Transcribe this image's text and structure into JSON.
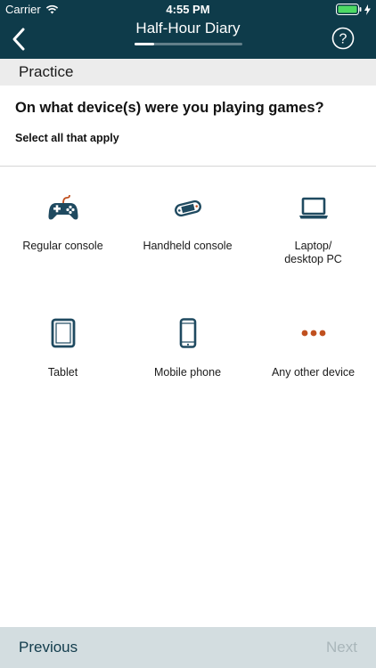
{
  "status_bar": {
    "carrier": "Carrier",
    "time": "4:55 PM"
  },
  "nav": {
    "title": "Half-Hour Diary",
    "progress": 0.18
  },
  "section": {
    "label": "Practice"
  },
  "question": {
    "text": "On what device(s) were you playing games?",
    "instruction": "Select all that apply"
  },
  "options": [
    {
      "label": "Regular console",
      "icon": "gamepad-icon"
    },
    {
      "label": "Handheld console",
      "icon": "handheld-console-icon"
    },
    {
      "label": "Laptop/\ndesktop PC",
      "icon": "laptop-icon"
    },
    {
      "label": "Tablet",
      "icon": "tablet-icon"
    },
    {
      "label": "Mobile phone",
      "icon": "mobile-phone-icon"
    },
    {
      "label": "Any other device",
      "icon": "more-dots-icon"
    }
  ],
  "footer": {
    "previous_label": "Previous",
    "next_label": "Next"
  },
  "colors": {
    "header": "#0e3b4a",
    "icon": "#1f4a60",
    "accent": "#c0501f",
    "footer": "#d3dde0"
  }
}
